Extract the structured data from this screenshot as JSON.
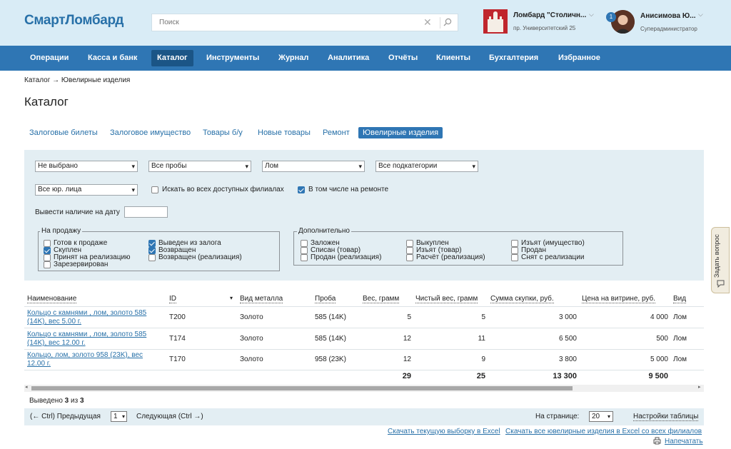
{
  "header": {
    "logo": "СмартЛомбард",
    "search_placeholder": "Поиск",
    "org_name": "Ломбард \"Столичн...",
    "org_address": "пр. Университетский 25",
    "user_name": "Анисимова Ю...",
    "user_role": "Суперадминистратор",
    "notification_count": "1"
  },
  "nav": [
    "Операции",
    "Касса и банк",
    "Каталог",
    "Инструменты",
    "Журнал",
    "Аналитика",
    "Отчёты",
    "Клиенты",
    "Бухгалтерия",
    "Избранное"
  ],
  "breadcrumb": "Каталог → Ювелирные изделия",
  "page_title": "Каталог",
  "tabs": [
    "Залоговые билеты",
    "Залоговое имущество",
    "Товары б/у",
    "Новые товары",
    "Ремонт",
    "Ювелирные изделия"
  ],
  "filters": {
    "select1": "Не выбрано",
    "select2": "Все пробы",
    "select3": "Лом",
    "select4": "Все подкатегории",
    "select5": "Все юр. лица",
    "search_all_branches": "Искать во всех доступных филиалах",
    "include_repair": "В том числе на ремонте",
    "date_label": "Вывести наличие на дату",
    "for_sale_legend": "На продажу",
    "for_sale": [
      {
        "label": "Готов к продаже",
        "checked": false
      },
      {
        "label": "Скуплен",
        "checked": true
      },
      {
        "label": "Принят на реализацию",
        "checked": false
      },
      {
        "label": "Зарезервирован",
        "checked": false
      },
      {
        "label": "Выведен из залога",
        "checked": true
      },
      {
        "label": "Возвращен",
        "checked": true
      },
      {
        "label": "Возвращен (реализация)",
        "checked": false
      }
    ],
    "extra_legend": "Дополнительно",
    "extra": [
      {
        "label": "Заложен",
        "checked": false
      },
      {
        "label": "Списан (товар)",
        "checked": false
      },
      {
        "label": "Продан (реализация)",
        "checked": false
      },
      {
        "label": "Выкуплен",
        "checked": false
      },
      {
        "label": "Изъят (товар)",
        "checked": false
      },
      {
        "label": "Расчёт (реализация)",
        "checked": false
      },
      {
        "label": "Изъят (имущество)",
        "checked": false
      },
      {
        "label": "Продан",
        "checked": false
      },
      {
        "label": "Снят с реализации",
        "checked": false
      }
    ]
  },
  "table": {
    "columns": [
      "Наименование",
      "ID",
      "Вид металла",
      "Проба",
      "Вес, грамм",
      "Чистый вес, грамм",
      "Сумма скупки, руб.",
      "Цена на витрине, руб.",
      "Вид"
    ],
    "rows": [
      {
        "name1": "Кольцо с камнями , лом, золото 585",
        "name2": "(14K), вес 5.00 г.",
        "id": "T200",
        "metal": "Золото",
        "probe": "585 (14K)",
        "weight": "5",
        "net": "5",
        "sum": "3 000",
        "price": "4 000",
        "kind": "Лом"
      },
      {
        "name1": "Кольцо с камнями , лом, золото 585",
        "name2": "(14K), вес 12.00 г.",
        "id": "T174",
        "metal": "Золото",
        "probe": "585 (14K)",
        "weight": "12",
        "net": "11",
        "sum": "6 500",
        "price": "500",
        "kind": "Лом"
      },
      {
        "name1": "Кольцо, лом, золото 958 (23K), вес",
        "name2": "12.00 г.",
        "id": "T170",
        "metal": "Золото",
        "probe": "958 (23K)",
        "weight": "12",
        "net": "9",
        "sum": "3 800",
        "price": "5 000",
        "kind": "Лом"
      }
    ],
    "totals": {
      "weight": "29",
      "net": "25",
      "sum": "13 300",
      "price": "9 500"
    }
  },
  "shown": {
    "prefix": "Выведено",
    "count": "3",
    "of": "из",
    "total": "3"
  },
  "pager": {
    "prev": "(← Ctrl) Предыдущая",
    "page": "1",
    "next": "Следующая (Ctrl →)",
    "per_page_label": "На странице:",
    "per_page": "20",
    "settings": "Настройки таблицы"
  },
  "footer": {
    "export_current": "Скачать текущую выборку в Excel",
    "export_all": "Скачать все ювелирные изделия в Excel со всех филиалов",
    "print": "Напечатать"
  },
  "side_tab": "Задать вопрос"
}
